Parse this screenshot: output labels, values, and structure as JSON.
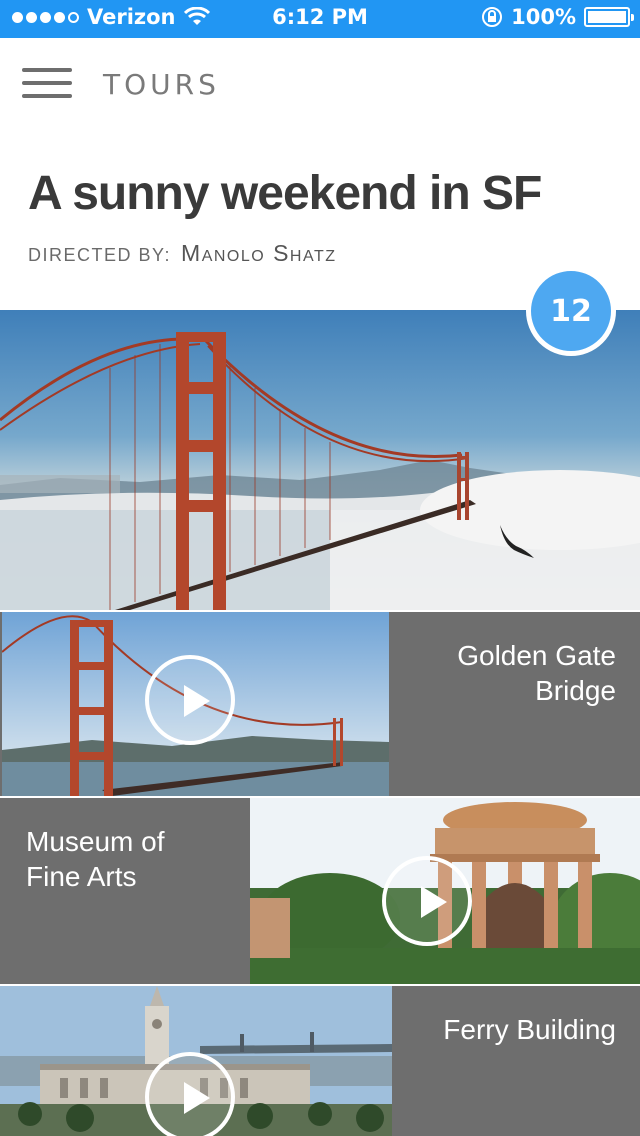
{
  "status_bar": {
    "carrier": "Verizon",
    "time": "6:12 PM",
    "battery": "100%"
  },
  "header": {
    "section_title": "TOURS",
    "menu_icon": "hamburger-menu-icon"
  },
  "tour": {
    "title": "A sunny weekend in SF",
    "directed_by_label": "DIRECTED BY:",
    "director": "Manolo Shatz",
    "count": "12"
  },
  "items": [
    {
      "label_line1": "Golden Gate",
      "label_line2": "Bridge"
    },
    {
      "label_line1": "Museum of",
      "label_line2": "Fine Arts"
    },
    {
      "label_line1": "Ferry Building",
      "label_line2": ""
    }
  ],
  "colors": {
    "status_bar": "#2196f3",
    "badge": "#4ea8f1",
    "item_panel": "#6e6e6e"
  }
}
